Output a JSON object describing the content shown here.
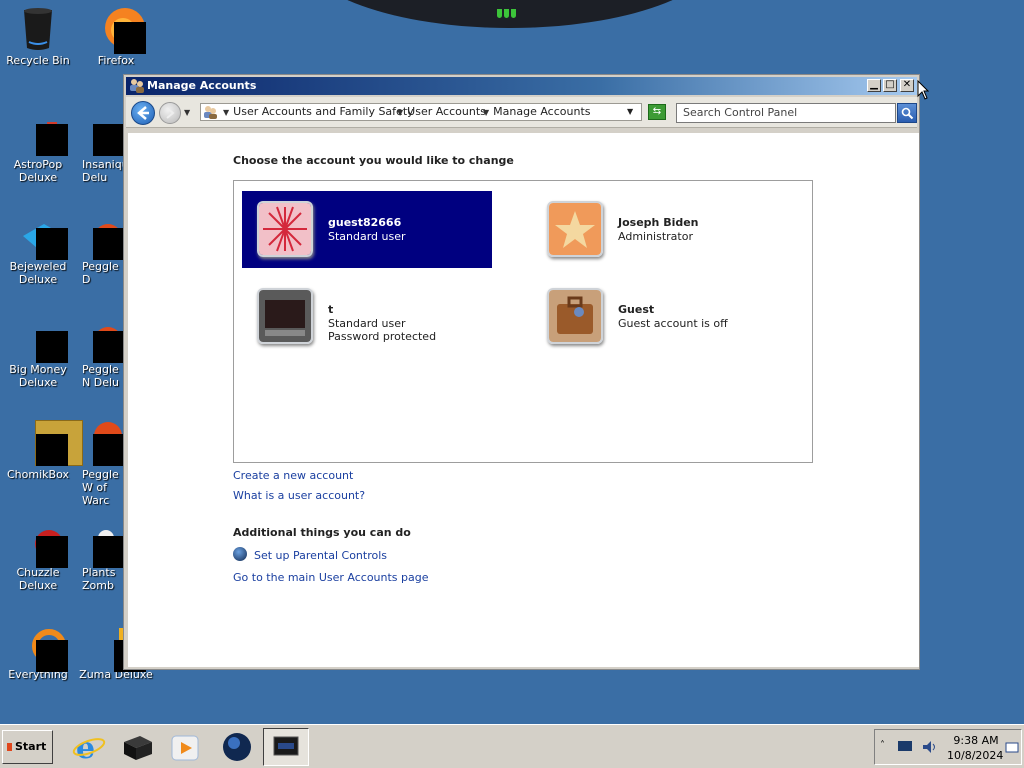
{
  "desktop": {
    "icons": [
      {
        "label": "Recycle Bin"
      },
      {
        "label": "Firefox"
      },
      {
        "label": "AstroPop Deluxe"
      },
      {
        "label": "Insaniquarium Deluxe",
        "visible_label": "Insaniqu Delu"
      },
      {
        "label": "Bejeweled Deluxe"
      },
      {
        "label": "Peggle D"
      },
      {
        "label": "Big Money Deluxe"
      },
      {
        "label": "Peggle N Delu"
      },
      {
        "label": "ChomikBox"
      },
      {
        "label": "Peggle W of Warc"
      },
      {
        "label": "Chuzzle Deluxe"
      },
      {
        "label": "Plants Zomb"
      },
      {
        "label": "Everything"
      },
      {
        "label": "Zuma Deluxe"
      }
    ]
  },
  "window": {
    "title": "Manage Accounts",
    "breadcrumb": [
      "User Accounts and Family Safety",
      "User Accounts",
      "Manage Accounts"
    ],
    "search_placeholder": "Search Control Panel",
    "heading": "Choose the account you would like to change",
    "accounts": [
      {
        "name": "guest82666",
        "type": "Standard user",
        "extra": "",
        "selected": true
      },
      {
        "name": "Joseph Biden",
        "type": "Administrator",
        "extra": "",
        "selected": false
      },
      {
        "name": "t",
        "type": "Standard user",
        "extra": "Password protected",
        "selected": false
      },
      {
        "name": "Guest",
        "type": "Guest account is off",
        "extra": "",
        "selected": false
      }
    ],
    "links": {
      "create": "Create a new account",
      "what_is": "What is a user account?"
    },
    "additional": {
      "heading": "Additional things you can do",
      "parental": "Set up Parental Controls",
      "main_page": "Go to the main User Accounts page"
    }
  },
  "taskbar": {
    "start_label": "Start",
    "time": "9:38 AM",
    "date": "10/8/2024"
  },
  "colors": {
    "desktop": "#3a6ea5",
    "selection": "#000080",
    "link": "#1a3fa0"
  }
}
